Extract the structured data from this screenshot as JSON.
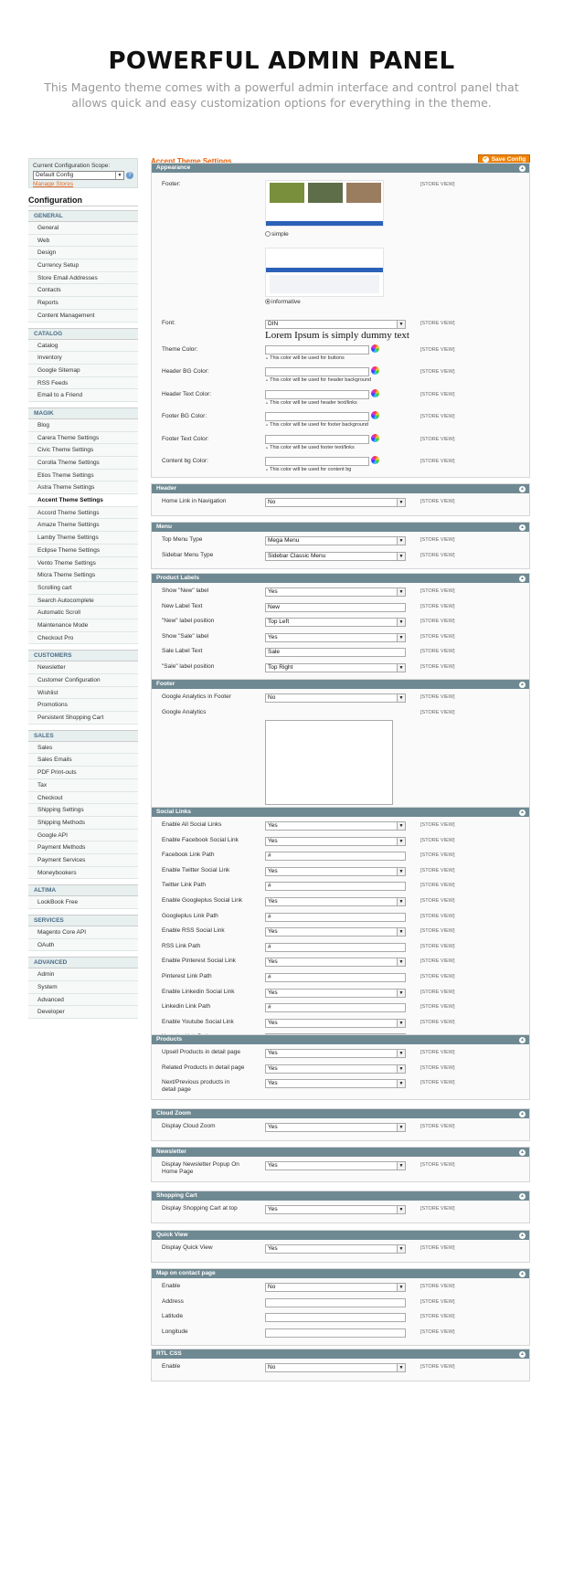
{
  "hero": {
    "title": "POWERFUL ADMIN PANEL",
    "subtitle": "This Magento theme comes with a powerful admin interface and control panel that allows quick and easy customization options for everything in the theme."
  },
  "sidebar": {
    "scope_label": "Current Configuration Scope:",
    "scope_value": "Default Config",
    "manage_stores": "Manage Stores",
    "title": "Configuration",
    "sections": [
      {
        "name": "GENERAL",
        "items": [
          "General",
          "Web",
          "Design",
          "Currency Setup",
          "Store Email Addresses",
          "Contacts",
          "Reports",
          "Content Management"
        ]
      },
      {
        "name": "CATALOG",
        "items": [
          "Catalog",
          "Inventory",
          "Google Sitemap",
          "RSS Feeds",
          "Email to a Friend"
        ]
      },
      {
        "name": "MAGIK",
        "items": [
          "Blog",
          "Carera Theme Settings",
          "Civic Theme Settings",
          "Corolla Theme Settings",
          "Etios Theme Settings",
          "Astra Theme Settings",
          "Accent Theme Settings",
          "Accord Theme Settings",
          "Amaze Theme Settings",
          "Lamby Theme Settings",
          "Eclipse Theme Settings",
          "Vento Theme Settings",
          "Micra Theme Settings",
          "Scrolling cart",
          "Search Autocomplete",
          "Automatic Scroll",
          "Maintenance Mode",
          "Checkout Pro"
        ]
      },
      {
        "name": "CUSTOMERS",
        "items": [
          "Newsletter",
          "Customer Configuration",
          "Wishlist",
          "Promotions",
          "Persistent Shopping Cart"
        ]
      },
      {
        "name": "SALES",
        "items": [
          "Sales",
          "Sales Emails",
          "PDF Print-outs",
          "Tax",
          "Checkout",
          "Shipping Settings",
          "Shipping Methods",
          "Google API",
          "Payment Methods",
          "Payment Services",
          "Moneybookers"
        ]
      },
      {
        "name": "ALTIMA",
        "items": [
          "LookBook Free"
        ]
      },
      {
        "name": "SERVICES",
        "items": [
          "Magento Core API",
          "OAuth"
        ]
      },
      {
        "name": "ADVANCED",
        "items": [
          "Admin",
          "System",
          "Advanced",
          "Developer"
        ]
      }
    ],
    "active_item": "Accent Theme Settings"
  },
  "main": {
    "page_title": "Accent Theme Settings",
    "save_label": "Save Config",
    "store_view": "[STORE VIEW]",
    "appearance": {
      "title": "Appearance",
      "footer_label": "Footer:",
      "opt_simple": "simple",
      "opt_informative": "informative",
      "font_label": "Font:",
      "font_value": "DIN",
      "font_preview": "Lorem Ipsum is simply dummy text",
      "colors": [
        {
          "label": "Theme Color:",
          "note": "This color will be used for buttons"
        },
        {
          "label": "Header BG Color:",
          "note": "This color will be used for header background"
        },
        {
          "label": "Header Text Color:",
          "note": "This color will be used header text/links"
        },
        {
          "label": "Footer BG Color:",
          "note": "This color will be used for footer background"
        },
        {
          "label": "Footer Text Color:",
          "note": "This color will be used footer text/links"
        },
        {
          "label": "Content bg Color:",
          "note": "This color will be used for content bg"
        }
      ]
    },
    "groups": [
      {
        "title": "Header",
        "rows": [
          {
            "label": "Home Link in Navigation",
            "type": "select",
            "value": "No"
          }
        ]
      },
      {
        "title": "Menu",
        "rows": [
          {
            "label": "Top Menu Type",
            "type": "select",
            "value": "Mega Menu"
          },
          {
            "label": "Sidebar Menu Type",
            "type": "select",
            "value": "Sidebar Classic Menu"
          }
        ]
      },
      {
        "title": "Product Labels",
        "rows": [
          {
            "label": "Show \"New\" label",
            "type": "select",
            "value": "Yes"
          },
          {
            "label": "New Label Text",
            "type": "text",
            "value": "New"
          },
          {
            "label": "\"New\" label position",
            "type": "select",
            "value": "Top Left"
          },
          {
            "label": "Show \"Sale\" label",
            "type": "select",
            "value": "Yes"
          },
          {
            "label": "Sale Label Text",
            "type": "text",
            "value": "Sale"
          },
          {
            "label": "\"Sale\" label position",
            "type": "select",
            "value": "Top Right"
          }
        ]
      },
      {
        "title": "Footer",
        "rows": [
          {
            "label": "Google Analytics in Footer",
            "type": "select",
            "value": "No"
          },
          {
            "label": "Google Analytics",
            "type": "textarea",
            "value": ""
          }
        ]
      },
      {
        "title": "Social Links",
        "rows": [
          {
            "label": "Enable All Social Links",
            "type": "select",
            "value": "Yes"
          },
          {
            "label": "Enable Facebook Social Link",
            "type": "select",
            "value": "Yes"
          },
          {
            "label": "Facebook Link Path",
            "type": "text",
            "value": "#"
          },
          {
            "label": "Enable Twitter Social Link",
            "type": "select",
            "value": "Yes"
          },
          {
            "label": "Twitter Link Path",
            "type": "text",
            "value": "#"
          },
          {
            "label": "Enable Googleplus Social Link",
            "type": "select",
            "value": "Yes"
          },
          {
            "label": "Googleplus Link Path",
            "type": "text",
            "value": "#"
          },
          {
            "label": "Enable RSS Social Link",
            "type": "select",
            "value": "Yes"
          },
          {
            "label": "RSS Link Path",
            "type": "text",
            "value": "#"
          },
          {
            "label": "Enable Pinterest Social Link",
            "type": "select",
            "value": "Yes"
          },
          {
            "label": "Pinterest Link Path",
            "type": "text",
            "value": "#"
          },
          {
            "label": "Enable Linkedin Social Link",
            "type": "select",
            "value": "Yes"
          },
          {
            "label": "Linkedin Link Path",
            "type": "text",
            "value": "#"
          },
          {
            "label": "Enable Youtube Social Link",
            "type": "select",
            "value": "Yes"
          },
          {
            "label": "Youtube Link Path",
            "type": "text",
            "value": "#"
          }
        ]
      },
      {
        "title": "Products",
        "rows": [
          {
            "label": "Upsell Products in detail page",
            "type": "select",
            "value": "Yes"
          },
          {
            "label": "Related Products in detail page",
            "type": "select",
            "value": "Yes"
          },
          {
            "label": "Next/Previous products in detail page",
            "type": "select",
            "value": "Yes"
          }
        ]
      },
      {
        "title": "Cloud Zoom",
        "rows": [
          {
            "label": "Display Cloud Zoom",
            "type": "select",
            "value": "Yes"
          }
        ]
      },
      {
        "title": "Newsletter",
        "rows": [
          {
            "label": "Display Newsletter Popup On Home Page",
            "type": "select",
            "value": "Yes"
          }
        ]
      },
      {
        "title": "Shopping Cart",
        "rows": [
          {
            "label": "Display Shopping Cart at top",
            "type": "select",
            "value": "Yes"
          }
        ]
      },
      {
        "title": "Quick View",
        "rows": [
          {
            "label": "Display Quick View",
            "type": "select",
            "value": "Yes"
          }
        ]
      },
      {
        "title": "Map on contact page",
        "rows": [
          {
            "label": "Enable",
            "type": "select",
            "value": "No"
          },
          {
            "label": "Address",
            "type": "text",
            "value": ""
          },
          {
            "label": "Latitude",
            "type": "text",
            "value": ""
          },
          {
            "label": "Longitude",
            "type": "text",
            "value": ""
          }
        ]
      },
      {
        "title": "RTL CSS",
        "rows": [
          {
            "label": "Enable",
            "type": "select",
            "value": "No"
          }
        ]
      }
    ]
  }
}
